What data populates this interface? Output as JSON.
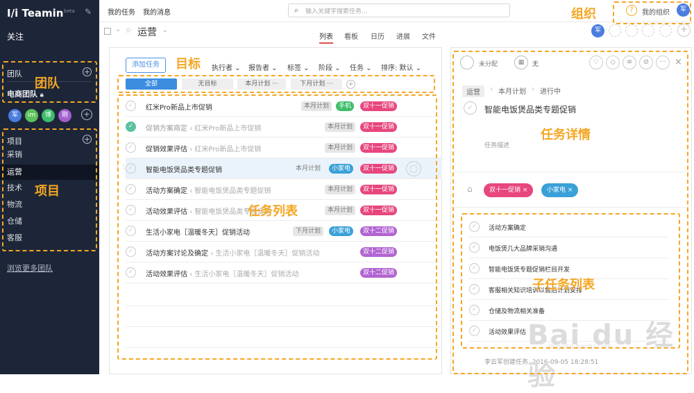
{
  "sidebar": {
    "logo": "Teamin",
    "beta": "beta",
    "follow": "关注",
    "team_header": "团队",
    "team_name": "电商团队",
    "members": [
      "军",
      "im",
      "博",
      "刚"
    ],
    "member_colors": [
      "#4a7de0",
      "#5bc25b",
      "#3ebd6a",
      "#a35fd0"
    ],
    "project_header": "项目",
    "projects": [
      "采销",
      "运营",
      "技术",
      "物流",
      "仓储",
      "客服"
    ],
    "active_project": "运营",
    "browse_more": "浏览更多团队"
  },
  "topbar": {
    "my_tasks": "我的任务",
    "my_messages": "我的消息",
    "search_placeholder": "输入关键字搜索任务...",
    "my_org": "我的组织",
    "user_avatar": "军"
  },
  "project_header": {
    "title": "运营",
    "tabs": [
      "列表",
      "看板",
      "日历",
      "进展",
      "文件"
    ],
    "active_tab": "列表",
    "member_avatar": "军"
  },
  "filters": {
    "add_task": "添加任务",
    "items": [
      "执行者",
      "报告者",
      "标签",
      "阶段",
      "任务",
      "排序: 默认"
    ],
    "segments": [
      "全部",
      "无目标",
      "本月计划",
      "下月计划"
    ],
    "more": "···"
  },
  "tasks": [
    {
      "title": "红米Pro新品上市促销",
      "parent": "",
      "plan": "本月计划",
      "tag1": "手机",
      "tag1_color": "green",
      "tag2": "双十一促销",
      "tag2_color": "pink",
      "done": false,
      "grey": false
    },
    {
      "title": "促销方案商定",
      "parent": "红米Pro新品上市促销",
      "plan": "本月计划",
      "tag1": "",
      "tag2": "双十一促销",
      "tag2_color": "pink",
      "done": true,
      "grey": true
    },
    {
      "title": "促销效果评估",
      "parent": "红米Pro新品上市促销",
      "plan": "本月计划",
      "tag1": "",
      "tag2": "双十一促销",
      "tag2_color": "pink",
      "done": false,
      "grey": false
    },
    {
      "title": "智能电饭煲品类专题促销",
      "parent": "",
      "plan": "本月计划",
      "tag1": "小家电",
      "tag1_color": "blue",
      "tag2": "双十一促销",
      "tag2_color": "pink",
      "done": false,
      "grey": false
    },
    {
      "title": "活动方案确定",
      "parent": "智能电饭煲品类专题促销",
      "plan": "本月计划",
      "tag1": "",
      "tag2": "双十一促销",
      "tag2_color": "pink",
      "done": false,
      "grey": false
    },
    {
      "title": "活动效果评估",
      "parent": "智能电饭煲品类专题促销",
      "plan": "本月计划",
      "tag1": "",
      "tag2": "双十一促销",
      "tag2_color": "pink",
      "done": false,
      "grey": false
    },
    {
      "title": "生活小家电［温暖冬天］促销活动",
      "parent": "",
      "plan": "下月计划",
      "tag1": "小家电",
      "tag1_color": "blue",
      "tag2": "双十二促销",
      "tag2_color": "purple",
      "done": false,
      "grey": false
    },
    {
      "title": "活动方案讨论及确定",
      "parent": "生活小家电［温暖冬天］促销活动",
      "plan": "下月计划",
      "tag1": "",
      "tag2": "双十二促销",
      "tag2_color": "purple",
      "done": false,
      "grey": false
    },
    {
      "title": "活动效果评估",
      "parent": "生活小家电［温暖冬天］促销活动",
      "plan": "下月计划",
      "tag1": "",
      "tag2": "双十二促销",
      "tag2_color": "purple",
      "done": false,
      "grey": false
    }
  ],
  "detail": {
    "assignee": "未分配",
    "due": "无",
    "breadcrumb": [
      "运营",
      "本月计划",
      "进行中"
    ],
    "title": "智能电饭煲品类专题促销",
    "desc_placeholder": "任务描述",
    "tags": [
      "双十一促销",
      "小家电"
    ],
    "subtasks": [
      "活动方案确定",
      "电饭煲几大品牌采销沟通",
      "智能电饭煲专题促销栏目开发",
      "客服相关知识培训以售后计划安排",
      "仓储及物流相关准备",
      "活动效果评估"
    ],
    "creator_line": "李云军创建任务  2016-09-05 18:28:51"
  },
  "annotations": {
    "team": "团队",
    "project": "项目",
    "goal": "目标",
    "task_list": "任务列表",
    "task_detail": "任务详情",
    "subtask_list": "子任务列表",
    "org": "组织"
  },
  "watermark": "Bai du 经验",
  "watermark_url": "jingyan.baidu.com",
  "colors": {
    "sidebar_bg": "#1d2638",
    "accent": "#3b8de0",
    "annotation": "#f5a623",
    "tab_active": "#e2504d"
  }
}
